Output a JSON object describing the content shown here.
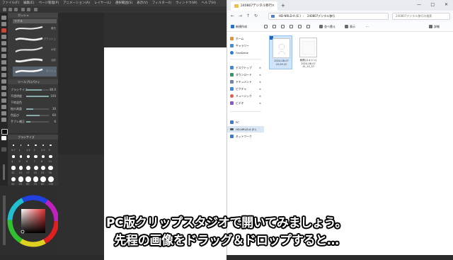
{
  "csp": {
    "menu": [
      "ファイル(F)",
      "編集(E)",
      "ページ管理(P)",
      "アニメーション(A)",
      "レイヤー(L)",
      "選択範囲(S)",
      "表示(V)",
      "フィルター(I)",
      "ウィンドウ(W)",
      "ヘルプ(H)"
    ],
    "subtool_header": "ガッシュ",
    "brush_tab": "リアル",
    "brushes": [
      "筆先",
      "グワッシュ",
      "水彩",
      "油彩",
      "ガッシュ",
      "不透明"
    ],
    "tool_property_header": "ツールプロパティ",
    "properties": [
      {
        "label": "ブラシサイズ",
        "value": "80.0"
      },
      {
        "label": "不透明度",
        "value": "100"
      },
      {
        "label": "下地混色",
        "value": ""
      },
      {
        "label": "絵の具量",
        "value": "30"
      },
      {
        "label": "色延び",
        "value": "60"
      },
      {
        "label": "手ブレ補正",
        "value": "6"
      }
    ],
    "brush_size_header": "ブラシサイズ",
    "brush_sizes": [
      "0.7",
      "1",
      "1.5",
      "2",
      "2.5",
      "3",
      "4",
      "5",
      "6",
      "7",
      "8",
      "10",
      "12",
      "15",
      "17",
      "20",
      "25",
      "30",
      "40",
      "50",
      "60",
      "70",
      "80",
      "100"
    ]
  },
  "explorer": {
    "tab_title": "240807デジタル移行",
    "new_tab": "+",
    "address_parts": [
      "HD-NRLD-A (E:)",
      "240807デジタル移行"
    ],
    "search_placeholder": "240807デジタル移行の検索",
    "commands": [
      "新規作成",
      "並べ替え",
      "表示",
      "詳細"
    ],
    "nav_items": [
      {
        "label": "ホーム",
        "icon": "home-icon",
        "color": "#e0943a"
      },
      {
        "label": "ギャラリー",
        "icon": "gallery-icon",
        "color": "#3e8ed8"
      },
      {
        "label": "OneDrive",
        "icon": "cloud-icon",
        "color": "#2c7ad6"
      },
      {
        "label": "デスクトップ",
        "icon": "desktop-icon",
        "color": "#3d8bd8"
      },
      {
        "label": "ダウンロード",
        "icon": "download-icon",
        "color": "#2e9a6a"
      },
      {
        "label": "ドキュメント",
        "icon": "document-icon",
        "color": "#6f86a8"
      },
      {
        "label": "ピクチャ",
        "icon": "pictures-icon",
        "color": "#3d8bd8"
      },
      {
        "label": "ミュージック",
        "icon": "music-icon",
        "color": "#e45a4c"
      },
      {
        "label": "ビデオ",
        "icon": "video-icon",
        "color": "#8a56c8"
      },
      {
        "label": "PC",
        "icon": "pc-icon",
        "color": "#3a7bd5"
      },
      {
        "label": "HD-NRLD-A (E:)",
        "icon": "drive-icon",
        "color": "#555555"
      },
      {
        "label": "ネットワーク",
        "icon": "network-icon",
        "color": "#3a7bd5"
      }
    ],
    "files": [
      {
        "name": "2024-08-07",
        "date": "15.09.22",
        "selected": true
      },
      {
        "name": "無題(スキャン)",
        "date": "2024-08-07 15_15_57",
        "selected": false
      }
    ]
  },
  "subtitles": {
    "line1": "PC版クリップスタジオで開いてみましょう。",
    "line2": "先程の画像をドラッグ＆ドロップすると…"
  },
  "colors": {
    "accent": "#1a66c9",
    "page_white": "#ffffff",
    "app_dark": "#2e2e2e"
  }
}
